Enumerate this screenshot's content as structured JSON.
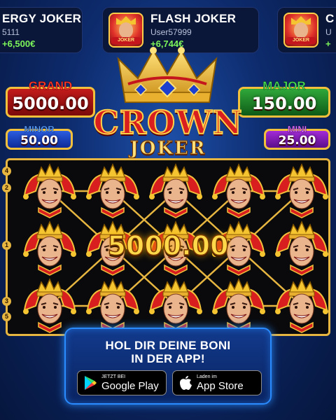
{
  "ticker": [
    {
      "game": "ERGY JOKER",
      "user": "5111",
      "amount": "+6,500€"
    },
    {
      "game": "FLASH JOKER",
      "user": "User57999",
      "amount": "+6,744€",
      "thumb_label": "JOKER"
    },
    {
      "game": "C",
      "user": "U",
      "amount": "+",
      "thumb_label": "JOKER"
    }
  ],
  "jackpots": {
    "grand": {
      "label": "GRAND",
      "value": "5000.00"
    },
    "major": {
      "label": "MAJOR",
      "value": "150.00"
    },
    "minor": {
      "label": "MINOR",
      "value": "50.00"
    },
    "mini": {
      "label": "MINI",
      "value": "25.00"
    }
  },
  "logo": {
    "line1": "CROWN",
    "line2": "JOKER"
  },
  "reels": {
    "symbol": "crown-joker-symbol",
    "rows": 3,
    "cols": 5,
    "win_amount": "5000.00",
    "line_numbers_left": [
      "4",
      "2",
      "1",
      "3",
      "5"
    ]
  },
  "promo": {
    "title": "HOL DIR DEINE BONI\nIN DER APP!",
    "google_play": {
      "small": "JETZT BEI",
      "big": "Google Play"
    },
    "app_store": {
      "small": "Laden im",
      "big": "App Store"
    }
  },
  "colors": {
    "gold": "#e6b640",
    "grand": "#c21b1b",
    "major": "#2fa83a",
    "minor": "#2a5de0",
    "mini": "#a32ad8",
    "win_green": "#7cf55a"
  }
}
